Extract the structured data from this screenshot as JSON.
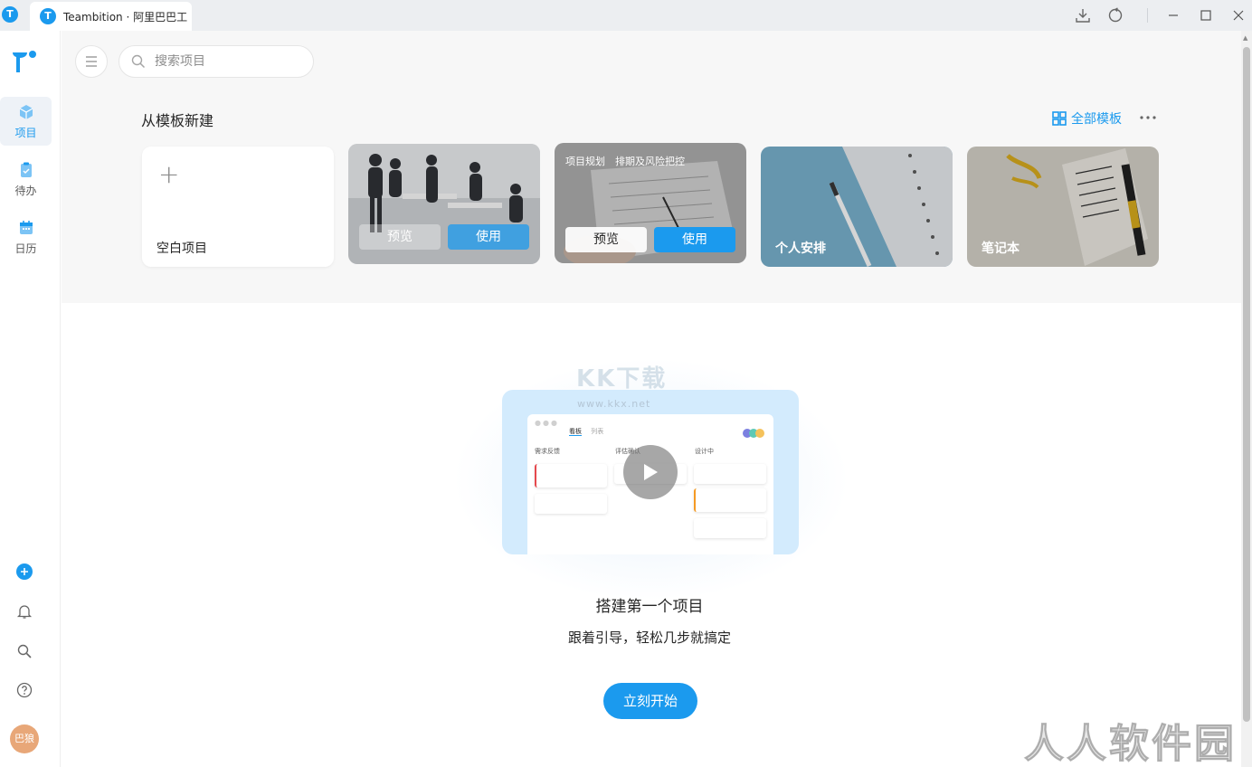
{
  "titlebar": {
    "app_icon": "T",
    "tab_title": "Teambition · 阿里巴巴工"
  },
  "sidebar": {
    "items": [
      {
        "label": "项目",
        "icon": "cube-icon",
        "active": true
      },
      {
        "label": "待办",
        "icon": "clipboard-check-icon",
        "active": false
      },
      {
        "label": "日历",
        "icon": "calendar-icon",
        "active": false
      }
    ],
    "avatar_text": "巴狼"
  },
  "search": {
    "placeholder": "搜索项目"
  },
  "templates": {
    "section_title": "从模板新建",
    "all_label": "全部模板",
    "blank_label": "空白项目",
    "preview_label": "预览",
    "use_label": "使用",
    "card_planning_title": "项目规划　排期及风险把控",
    "card_personal_label": "个人安排",
    "card_notebook_label": "笔记本"
  },
  "illustration": {
    "tab_board": "看板",
    "tab_list": "列表",
    "col1": "需求反馈",
    "col2": "评估确认",
    "col3": "设计中"
  },
  "empty_state": {
    "title": "搭建第一个项目",
    "subtitle": "跟着引导，轻松几步就搞定",
    "start_label": "立刻开始"
  },
  "watermarks": {
    "kk": "KK下载",
    "url": "www.kkx.net",
    "corner": "人人软件园"
  },
  "colors": {
    "accent": "#1b9aee",
    "sidebar_active_bg": "#eef2f7",
    "top_band_bg": "#f7f7f7"
  }
}
